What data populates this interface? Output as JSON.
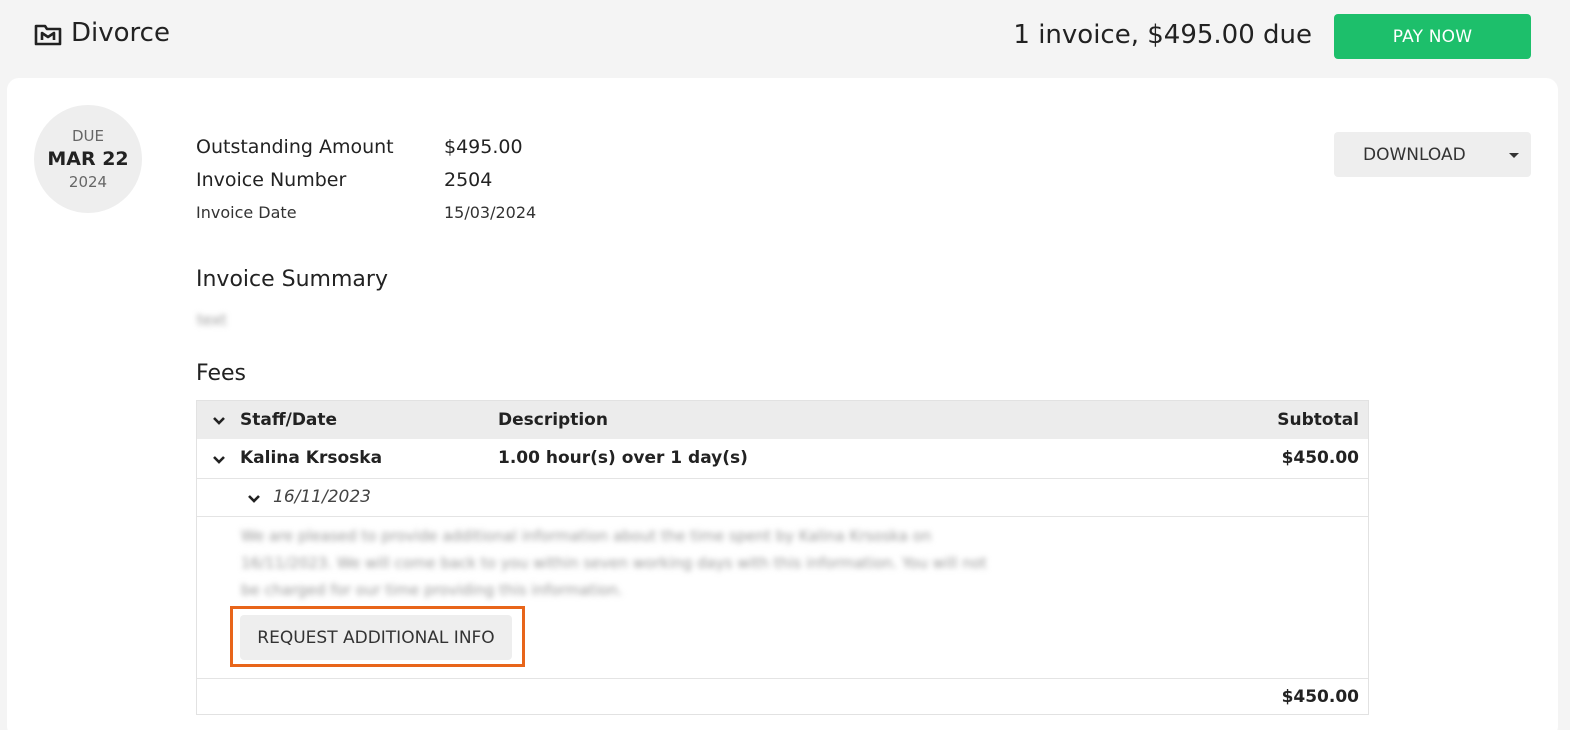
{
  "header": {
    "matter_title": "Divorce",
    "due_summary": "1 invoice, $495.00 due",
    "pay_button": "PAY NOW",
    "pay_color": "#1dbf6b"
  },
  "due": {
    "label": "DUE",
    "day": "MAR 22",
    "year": "2024"
  },
  "invoice": {
    "outstanding_label": "Outstanding Amount",
    "outstanding_value": "$495.00",
    "number_label": "Invoice Number",
    "number_value": "2504",
    "date_label": "Invoice Date",
    "date_value": "15/03/2024"
  },
  "download_button": "DOWNLOAD",
  "summary": {
    "title": "Invoice Summary",
    "text": "text"
  },
  "fees": {
    "title": "Fees",
    "headers": {
      "staff_date": "Staff/Date",
      "description": "Description",
      "subtotal": "Subtotal"
    },
    "staff_row": {
      "name": "Kalina Krsoska",
      "description": "1.00 hour(s) over 1 day(s)",
      "subtotal": "$450.00"
    },
    "date_row": {
      "date": "16/11/2023"
    },
    "detail_lines": [
      "We are pleased to provide additional information about the time spent by Kalina Krsoska on",
      "16/11/2023. We will come back to you within seven working days with this information. You will not",
      "be charged for our time providing this information."
    ],
    "request_button": "REQUEST ADDITIONAL INFO",
    "total": "$450.00"
  },
  "highlight_color": "#e8651a"
}
